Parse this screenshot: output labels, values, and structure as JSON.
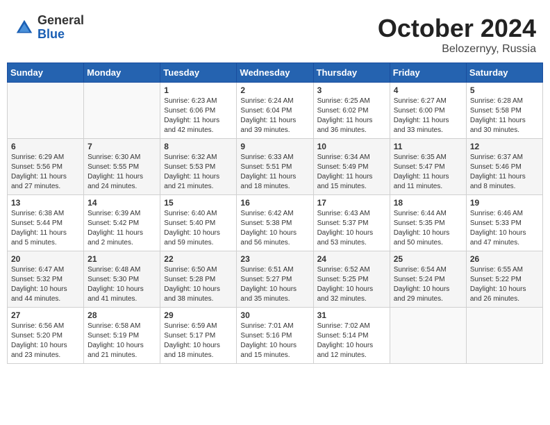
{
  "header": {
    "logo_general": "General",
    "logo_blue": "Blue",
    "month": "October 2024",
    "location": "Belozernyy, Russia"
  },
  "weekdays": [
    "Sunday",
    "Monday",
    "Tuesday",
    "Wednesday",
    "Thursday",
    "Friday",
    "Saturday"
  ],
  "weeks": [
    [
      {
        "day": "",
        "info": ""
      },
      {
        "day": "",
        "info": ""
      },
      {
        "day": "1",
        "info": "Sunrise: 6:23 AM\nSunset: 6:06 PM\nDaylight: 11 hours\nand 42 minutes."
      },
      {
        "day": "2",
        "info": "Sunrise: 6:24 AM\nSunset: 6:04 PM\nDaylight: 11 hours\nand 39 minutes."
      },
      {
        "day": "3",
        "info": "Sunrise: 6:25 AM\nSunset: 6:02 PM\nDaylight: 11 hours\nand 36 minutes."
      },
      {
        "day": "4",
        "info": "Sunrise: 6:27 AM\nSunset: 6:00 PM\nDaylight: 11 hours\nand 33 minutes."
      },
      {
        "day": "5",
        "info": "Sunrise: 6:28 AM\nSunset: 5:58 PM\nDaylight: 11 hours\nand 30 minutes."
      }
    ],
    [
      {
        "day": "6",
        "info": "Sunrise: 6:29 AM\nSunset: 5:56 PM\nDaylight: 11 hours\nand 27 minutes."
      },
      {
        "day": "7",
        "info": "Sunrise: 6:30 AM\nSunset: 5:55 PM\nDaylight: 11 hours\nand 24 minutes."
      },
      {
        "day": "8",
        "info": "Sunrise: 6:32 AM\nSunset: 5:53 PM\nDaylight: 11 hours\nand 21 minutes."
      },
      {
        "day": "9",
        "info": "Sunrise: 6:33 AM\nSunset: 5:51 PM\nDaylight: 11 hours\nand 18 minutes."
      },
      {
        "day": "10",
        "info": "Sunrise: 6:34 AM\nSunset: 5:49 PM\nDaylight: 11 hours\nand 15 minutes."
      },
      {
        "day": "11",
        "info": "Sunrise: 6:35 AM\nSunset: 5:47 PM\nDaylight: 11 hours\nand 11 minutes."
      },
      {
        "day": "12",
        "info": "Sunrise: 6:37 AM\nSunset: 5:46 PM\nDaylight: 11 hours\nand 8 minutes."
      }
    ],
    [
      {
        "day": "13",
        "info": "Sunrise: 6:38 AM\nSunset: 5:44 PM\nDaylight: 11 hours\nand 5 minutes."
      },
      {
        "day": "14",
        "info": "Sunrise: 6:39 AM\nSunset: 5:42 PM\nDaylight: 11 hours\nand 2 minutes."
      },
      {
        "day": "15",
        "info": "Sunrise: 6:40 AM\nSunset: 5:40 PM\nDaylight: 10 hours\nand 59 minutes."
      },
      {
        "day": "16",
        "info": "Sunrise: 6:42 AM\nSunset: 5:38 PM\nDaylight: 10 hours\nand 56 minutes."
      },
      {
        "day": "17",
        "info": "Sunrise: 6:43 AM\nSunset: 5:37 PM\nDaylight: 10 hours\nand 53 minutes."
      },
      {
        "day": "18",
        "info": "Sunrise: 6:44 AM\nSunset: 5:35 PM\nDaylight: 10 hours\nand 50 minutes."
      },
      {
        "day": "19",
        "info": "Sunrise: 6:46 AM\nSunset: 5:33 PM\nDaylight: 10 hours\nand 47 minutes."
      }
    ],
    [
      {
        "day": "20",
        "info": "Sunrise: 6:47 AM\nSunset: 5:32 PM\nDaylight: 10 hours\nand 44 minutes."
      },
      {
        "day": "21",
        "info": "Sunrise: 6:48 AM\nSunset: 5:30 PM\nDaylight: 10 hours\nand 41 minutes."
      },
      {
        "day": "22",
        "info": "Sunrise: 6:50 AM\nSunset: 5:28 PM\nDaylight: 10 hours\nand 38 minutes."
      },
      {
        "day": "23",
        "info": "Sunrise: 6:51 AM\nSunset: 5:27 PM\nDaylight: 10 hours\nand 35 minutes."
      },
      {
        "day": "24",
        "info": "Sunrise: 6:52 AM\nSunset: 5:25 PM\nDaylight: 10 hours\nand 32 minutes."
      },
      {
        "day": "25",
        "info": "Sunrise: 6:54 AM\nSunset: 5:24 PM\nDaylight: 10 hours\nand 29 minutes."
      },
      {
        "day": "26",
        "info": "Sunrise: 6:55 AM\nSunset: 5:22 PM\nDaylight: 10 hours\nand 26 minutes."
      }
    ],
    [
      {
        "day": "27",
        "info": "Sunrise: 6:56 AM\nSunset: 5:20 PM\nDaylight: 10 hours\nand 23 minutes."
      },
      {
        "day": "28",
        "info": "Sunrise: 6:58 AM\nSunset: 5:19 PM\nDaylight: 10 hours\nand 21 minutes."
      },
      {
        "day": "29",
        "info": "Sunrise: 6:59 AM\nSunset: 5:17 PM\nDaylight: 10 hours\nand 18 minutes."
      },
      {
        "day": "30",
        "info": "Sunrise: 7:01 AM\nSunset: 5:16 PM\nDaylight: 10 hours\nand 15 minutes."
      },
      {
        "day": "31",
        "info": "Sunrise: 7:02 AM\nSunset: 5:14 PM\nDaylight: 10 hours\nand 12 minutes."
      },
      {
        "day": "",
        "info": ""
      },
      {
        "day": "",
        "info": ""
      }
    ]
  ]
}
